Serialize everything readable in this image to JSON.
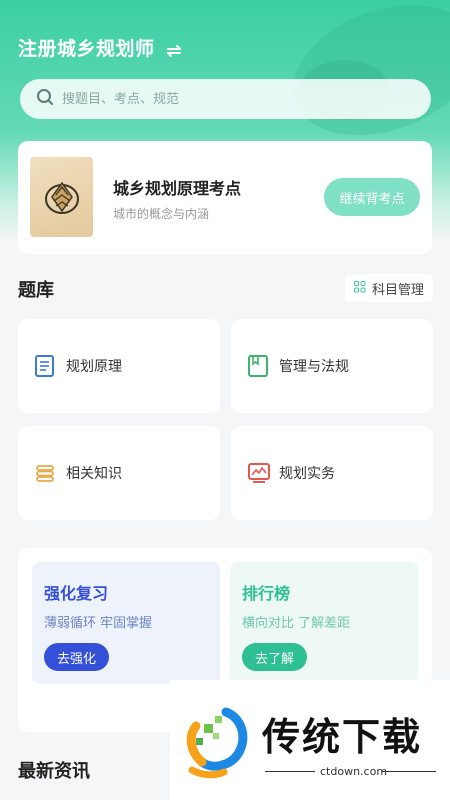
{
  "header": {
    "title": "注册城乡规划师",
    "switch_icon": "switch-icon",
    "search_placeholder": "搜题目、考点、规范"
  },
  "continue_card": {
    "book_title": "城乡规划原理考点",
    "book_subtitle": "城市的概念与内涵",
    "continue_label": "继续背考点"
  },
  "question_bank": {
    "title": "题库",
    "manage_label": "科目管理",
    "subjects": [
      {
        "label": "规划原理",
        "icon": "book-icon",
        "color": "#3a7bd5"
      },
      {
        "label": "管理与法规",
        "icon": "bookmark-book-icon",
        "color": "#3fb36e"
      },
      {
        "label": "相关知识",
        "icon": "stack-icon",
        "color": "#e6a94a"
      },
      {
        "label": "规划实务",
        "icon": "monitor-chart-icon",
        "color": "#e05a52"
      }
    ]
  },
  "practice": {
    "review": {
      "title": "强化复习",
      "subtitle": "薄弱循环 牢固掌握",
      "button": "去强化"
    },
    "ranking": {
      "title": "排行榜",
      "subtitle": "横向对比 了解差距",
      "button": "去了解"
    }
  },
  "news": {
    "title": "最新资讯"
  },
  "watermark": {
    "text": "传统下载",
    "url": "ctdown.com"
  },
  "colors": {
    "accent": "#3ccfa4",
    "review_blue": "#3550d8",
    "ranking_green": "#2fbf94"
  }
}
